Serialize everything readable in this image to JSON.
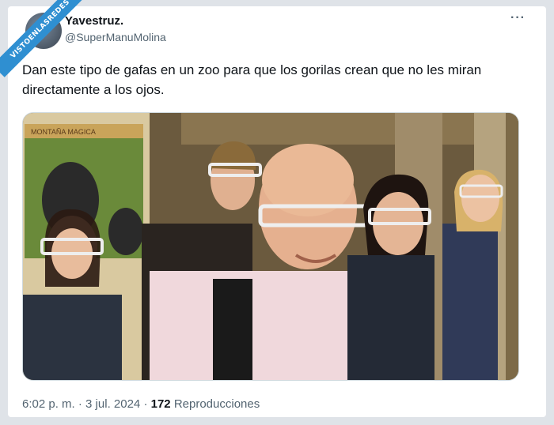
{
  "watermark": "VISTOENLASREDES",
  "tweet": {
    "display_name": "Yavestruz.",
    "handle": "@SuperManuMolina",
    "more_icon": "more-options-icon",
    "text": "Dan este tipo de gafas en un zoo para que los gorilas crean que no les miran directamente a los ojos.",
    "photo_sign": "MONTAÑA MAGICA",
    "time": "6:02 p. m.",
    "separator": "·",
    "date": "3 jul. 2024",
    "views_count": "172",
    "views_label": "Reproducciones"
  }
}
